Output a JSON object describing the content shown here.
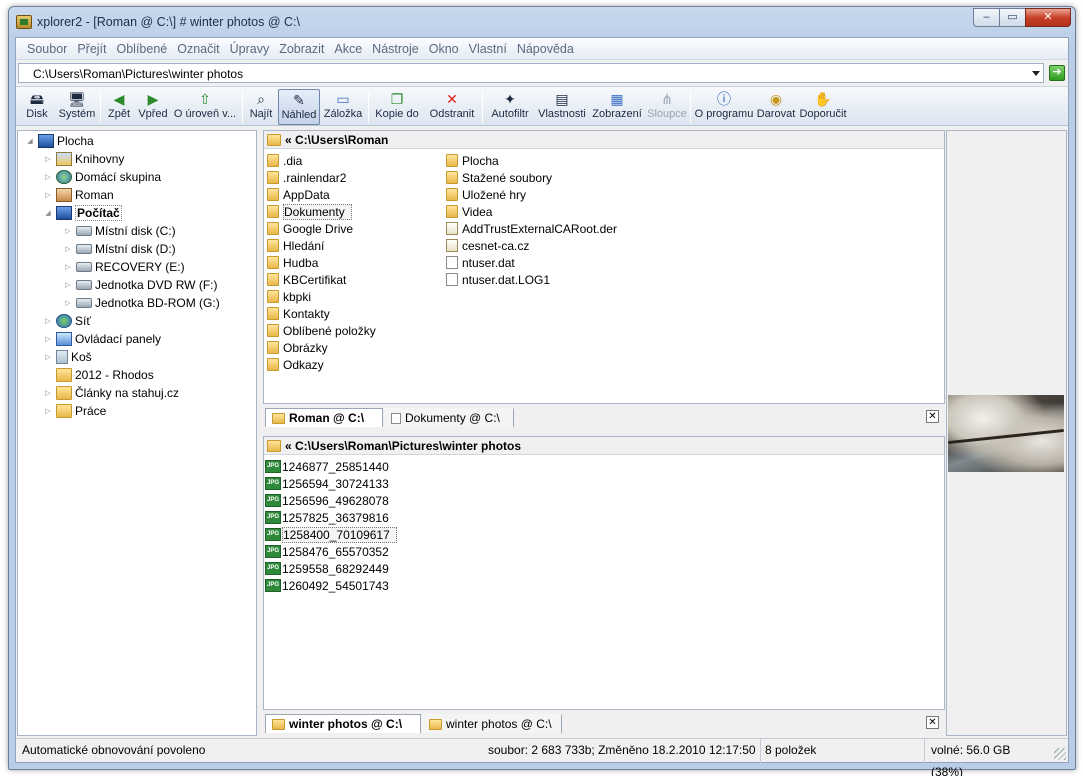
{
  "window": {
    "title": "xplorer2 - [Roman @ C:\\] # winter photos @ C:\\"
  },
  "menu": [
    "Soubor",
    "Přejít",
    "Oblíbené",
    "Označit",
    "Úpravy",
    "Zobrazit",
    "Akce",
    "Nástroje",
    "Okno",
    "Vlastní",
    "Nápověda"
  ],
  "address": {
    "path": "C:\\Users\\Roman\\Pictures\\winter photos"
  },
  "toolbar": {
    "disk": "Disk",
    "system": "Systém",
    "back": "Zpět",
    "forward": "Vpřed",
    "up": "O úroveň v...",
    "find": "Najít",
    "preview": "Náhled",
    "bookmark": "Záložka",
    "copy_to": "Kopie do",
    "delete": "Odstranit",
    "autofilter": "Autofiltr",
    "properties": "Vlastnosti",
    "view": "Zobrazení",
    "columns": "Sloupce",
    "about": "O programu",
    "donate": "Darovat",
    "recommend": "Doporučit"
  },
  "tree": {
    "desktop": "Plocha",
    "libraries": "Knihovny",
    "homegroup": "Domácí skupina",
    "roman": "Roman",
    "computer": "Počítač",
    "drive_c": "Místní disk (C:)",
    "drive_d": "Místní disk (D:)",
    "drive_e": "RECOVERY (E:)",
    "drive_f": "Jednotka DVD RW (F:)",
    "drive_g": "Jednotka BD-ROM (G:)",
    "network": "Síť",
    "control_panel": "Ovládací panely",
    "recycle": "Koš",
    "f_rhodos": "2012 - Rhodos",
    "f_clanky": "Články na stahuj.cz",
    "f_prace": "Práce"
  },
  "top_pane": {
    "path": "« C:\\Users\\Roman",
    "col1": [
      ".dia",
      ".rainlendar2",
      "AppData",
      "Dokumenty",
      "Google Drive",
      "Hledání",
      "Hudba",
      "KBCertifikat",
      "kbpki",
      "Kontakty",
      "Oblíbené položky",
      "Obrázky",
      "Odkazy"
    ],
    "col2": [
      "Plocha",
      "Stažené soubory",
      "Uložené hry",
      "Videa",
      "AddTrustExternalCARoot.der",
      "cesnet-ca.cz",
      "ntuser.dat",
      "ntuser.dat.LOG1"
    ],
    "tab_active": "Roman @ C:\\",
    "tab_inactive": "Dokumenty @ C:\\"
  },
  "bottom_pane": {
    "path": "« C:\\Users\\Roman\\Pictures\\winter photos",
    "files": [
      "1246877_25851440",
      "1256594_30724133",
      "1256596_49628078",
      "1257825_36379816",
      "1258400_70109617",
      "1258476_65570352",
      "1259558_68292449",
      "1260492_54501743"
    ],
    "tab_active": "winter photos @ C:\\",
    "tab_inactive": "winter photos @ C:\\"
  },
  "status": {
    "refresh": "Automatické obnovování povoleno",
    "file_info": "soubor: 2 683 733b; Změněno 18.2.2010 12:17:50",
    "count": "8 položek",
    "free": "volné: 56.0 GB (38%)"
  }
}
